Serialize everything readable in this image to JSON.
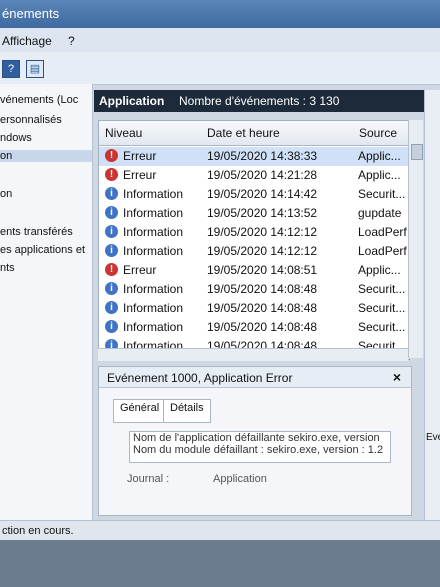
{
  "window": {
    "title": "énements"
  },
  "menu": {
    "items": [
      "Affichage",
      "?"
    ]
  },
  "toolbar": {
    "help_label": "?"
  },
  "left_nav": {
    "items": [
      "vénements (Loc",
      "ersonnalisés",
      "ndows",
      "on",
      "on",
      "ents transférés",
      "es applications et",
      "nts"
    ]
  },
  "header": {
    "log_name": "Application",
    "count_label": "Nombre d'événements : 3 130"
  },
  "columns": [
    "Niveau",
    "Date et heure",
    "Source"
  ],
  "events": [
    {
      "level": "Erreur",
      "type": "error",
      "date": "19/05/2020 14:38:33",
      "source": "Applic..."
    },
    {
      "level": "Erreur",
      "type": "error",
      "date": "19/05/2020 14:21:28",
      "source": "Applic..."
    },
    {
      "level": "Information",
      "type": "info",
      "date": "19/05/2020 14:14:42",
      "source": "Securit..."
    },
    {
      "level": "Information",
      "type": "info",
      "date": "19/05/2020 14:13:52",
      "source": "gupdate"
    },
    {
      "level": "Information",
      "type": "info",
      "date": "19/05/2020 14:12:12",
      "source": "LoadPerf"
    },
    {
      "level": "Information",
      "type": "info",
      "date": "19/05/2020 14:12:12",
      "source": "LoadPerf"
    },
    {
      "level": "Erreur",
      "type": "error",
      "date": "19/05/2020 14:08:51",
      "source": "Applic..."
    },
    {
      "level": "Information",
      "type": "info",
      "date": "19/05/2020 14:08:48",
      "source": "Securit..."
    },
    {
      "level": "Information",
      "type": "info",
      "date": "19/05/2020 14:08:48",
      "source": "Securit..."
    },
    {
      "level": "Information",
      "type": "info",
      "date": "19/05/2020 14:08:48",
      "source": "Securit..."
    },
    {
      "level": "Information",
      "type": "info",
      "date": "19/05/2020 14:08:48",
      "source": "Securit"
    }
  ],
  "detail": {
    "title": "Evénement 1000, Application Error",
    "tabs": [
      "Général",
      "Détails"
    ],
    "line1": "Nom de l'application défaillante sekiro.exe, version",
    "line2": "Nom du module défaillant : sekiro.exe, version : 1.2",
    "journal_label": "Journal :",
    "journal_value": "Application"
  },
  "right_panel": {
    "label": "Evé"
  },
  "status": {
    "text": "ction en cours."
  }
}
